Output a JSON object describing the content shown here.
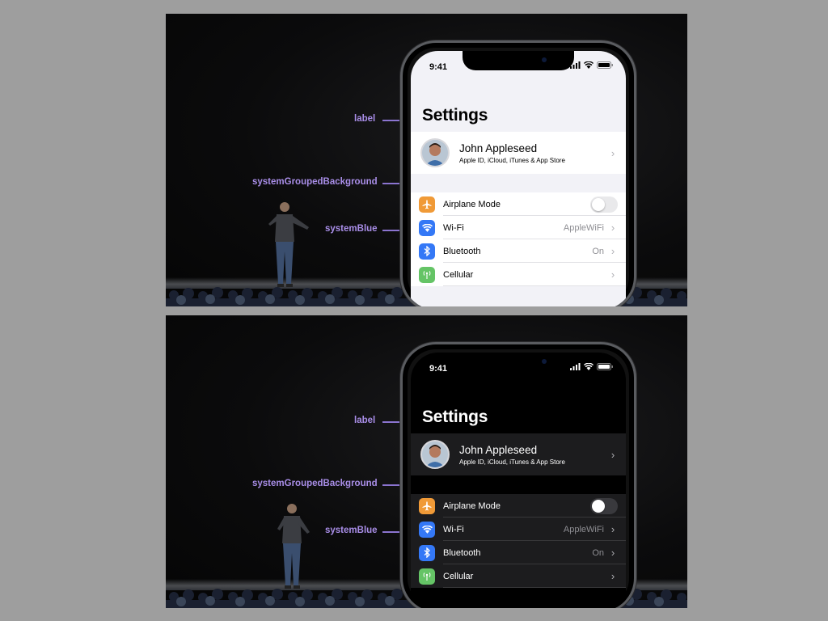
{
  "slides": [
    {
      "theme": "light",
      "colors": {
        "background": "#f2f2f7",
        "cell": "#ffffff",
        "text": "#000000"
      },
      "status": {
        "time": "9:41"
      },
      "settings": {
        "title": "Settings",
        "profile": {
          "name": "John Appleseed",
          "subtitle": "Apple ID, iCloud, iTunes & App Store"
        },
        "rows": [
          {
            "label": "Airplane Mode",
            "icon": "airplane-icon",
            "icon_bg": "#f09a37",
            "control": "toggle",
            "toggle_on": false
          },
          {
            "label": "Wi-Fi",
            "icon": "wifi-icon",
            "icon_bg": "#3478f6",
            "value": "AppleWiFi"
          },
          {
            "label": "Bluetooth",
            "icon": "bluetooth-icon",
            "icon_bg": "#3478f6",
            "value": "On"
          },
          {
            "label": "Cellular",
            "icon": "cellular-icon",
            "icon_bg": "#65c466",
            "value": ""
          }
        ]
      },
      "callouts": {
        "label": "label",
        "background": "systemGroupedBackground",
        "accent": "systemBlue"
      }
    },
    {
      "theme": "dark",
      "colors": {
        "background": "#000000",
        "cell": "#1c1c1e",
        "text": "#ffffff"
      },
      "status": {
        "time": "9:41"
      },
      "settings": {
        "title": "Settings",
        "profile": {
          "name": "John Appleseed",
          "subtitle": "Apple ID, iCloud, iTunes & App Store"
        },
        "rows": [
          {
            "label": "Airplane Mode",
            "icon": "airplane-icon",
            "icon_bg": "#f09a37",
            "control": "toggle",
            "toggle_on": false
          },
          {
            "label": "Wi-Fi",
            "icon": "wifi-icon",
            "icon_bg": "#3478f6",
            "value": "AppleWiFi"
          },
          {
            "label": "Bluetooth",
            "icon": "bluetooth-icon",
            "icon_bg": "#3478f6",
            "value": "On"
          },
          {
            "label": "Cellular",
            "icon": "cellular-icon",
            "icon_bg": "#65c466",
            "value": ""
          }
        ]
      },
      "callouts": {
        "label": "label",
        "background": "systemGroupedBackground",
        "accent": "systemBlue"
      }
    }
  ],
  "callout_color": "#a98ee8"
}
